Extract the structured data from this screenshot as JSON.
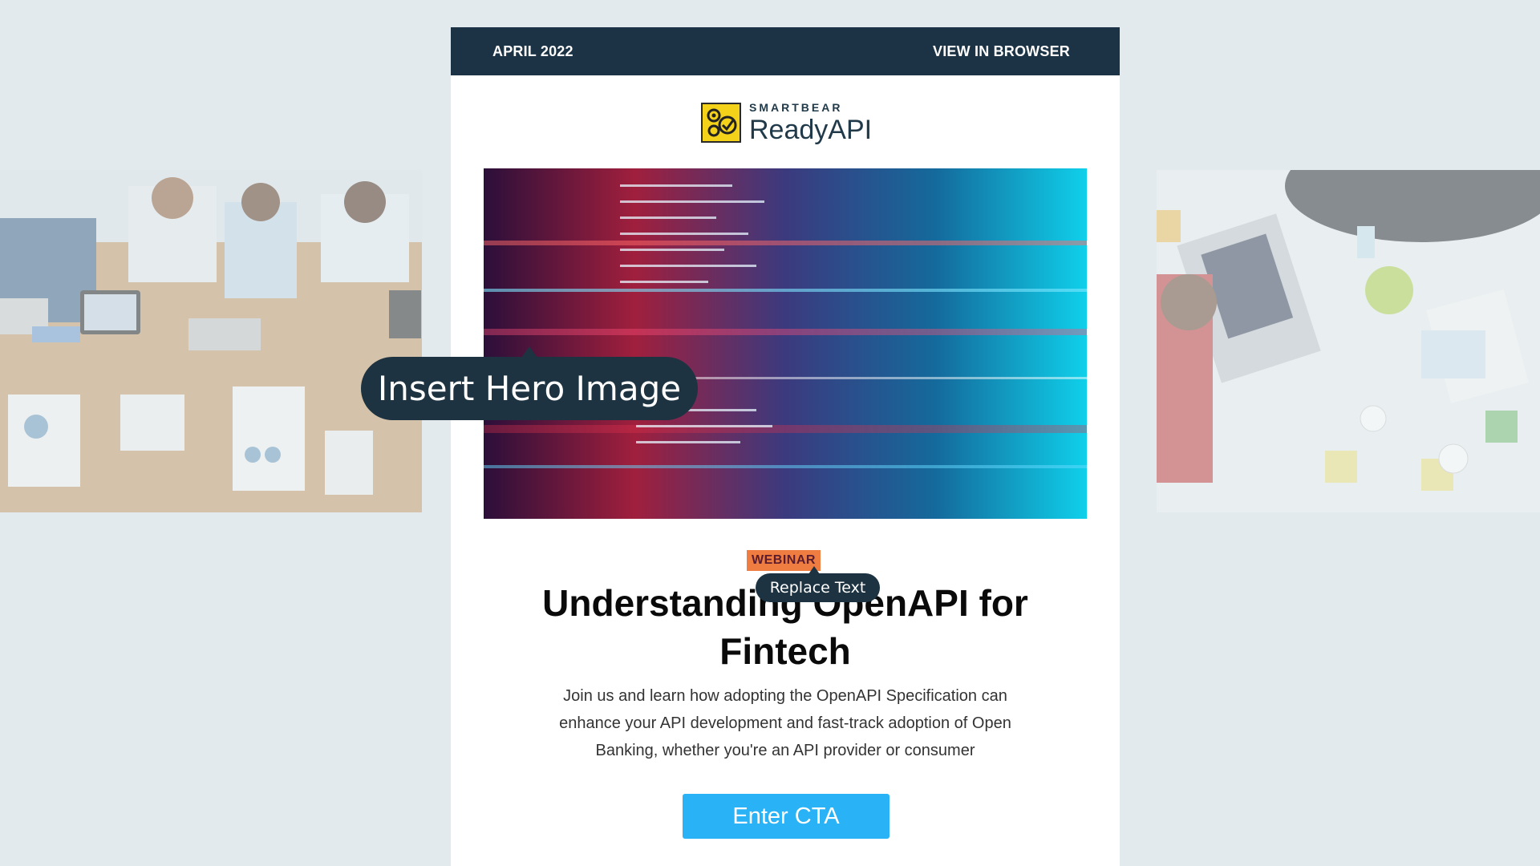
{
  "header": {
    "date_label": "APRIL 2022",
    "view_link": "VIEW IN BROWSER"
  },
  "logo": {
    "brand_small": "SMARTBEAR",
    "brand_big": "ReadyAPI"
  },
  "content": {
    "badge": "WEBINAR",
    "headline_line1": "Understanding OpenAPI for",
    "headline_line2": "Fintech",
    "body_line1": "Join us and learn how adopting the OpenAPI Specification can",
    "body_line2": "enhance your API development and fast-track adoption of Open",
    "body_line3": "Banking, whether you're an API provider or consumer",
    "cta_label": "Enter CTA"
  },
  "tooltips": {
    "hero": "Insert Hero Image",
    "text": "Replace Text"
  },
  "colors": {
    "topbar": "#1b3344",
    "badge": "#ef7c41",
    "cta": "#29b3f6",
    "tooltip": "#1d3341"
  },
  "icons": [
    "readyapi-logo-icon"
  ]
}
